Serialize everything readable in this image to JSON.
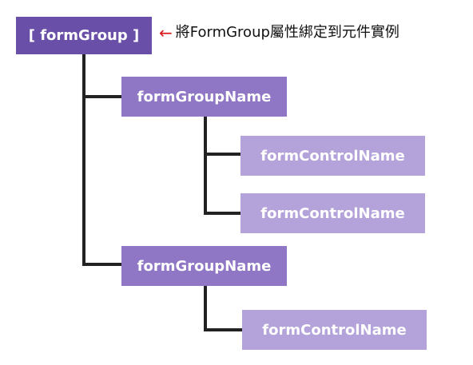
{
  "root": {
    "label": "[ formGroup ]"
  },
  "annotation": {
    "arrow": "←",
    "text": "將FormGroup屬性綁定到元件實例",
    "arrow_color": "#D71920"
  },
  "groups": [
    {
      "label": "formGroupName",
      "controls": [
        {
          "label": "formControlName"
        },
        {
          "label": "formControlName"
        }
      ]
    },
    {
      "label": "formGroupName",
      "controls": [
        {
          "label": "formControlName"
        }
      ]
    }
  ],
  "colors": {
    "root": "#6A4FA8",
    "group": "#8F77C6",
    "control": "#B3A3DA",
    "connector": "#222222"
  }
}
